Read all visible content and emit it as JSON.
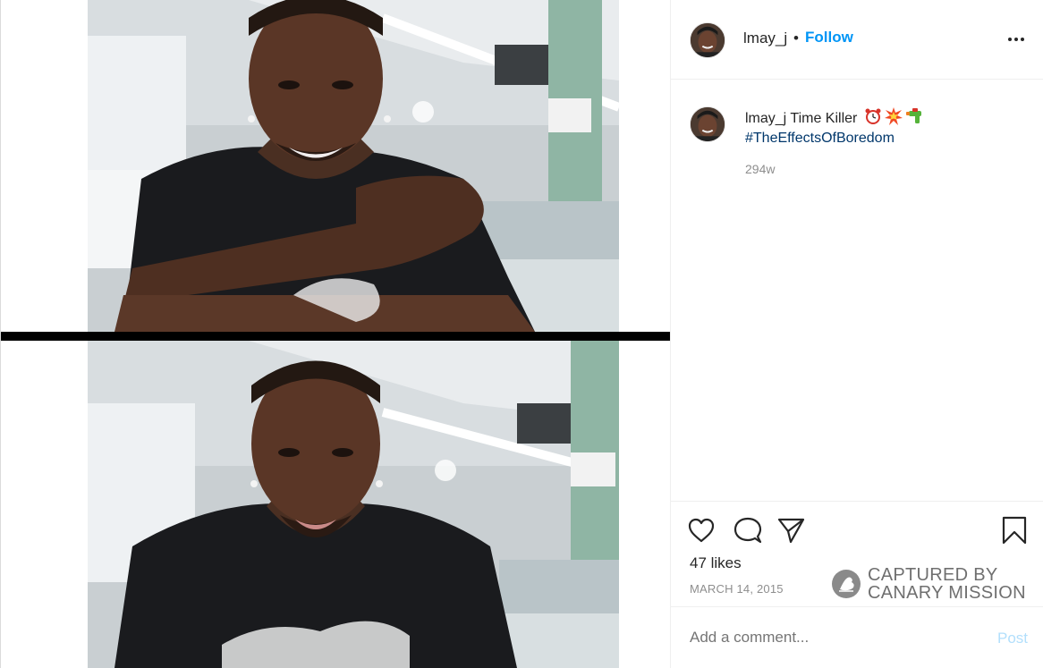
{
  "post": {
    "username": "lmay_j",
    "separator": "•",
    "follow_label": "Follow",
    "more_icon": "more-options-icon"
  },
  "caption": {
    "username": "lmay_j",
    "text": "Time Killer",
    "emojis": [
      "alarm-clock",
      "collision",
      "water-pistol"
    ],
    "hashtag": "#TheEffectsOfBoredom",
    "age": "294w"
  },
  "actions": {
    "icons": [
      "heart-icon",
      "comment-icon",
      "share-icon",
      "bookmark-icon"
    ],
    "likes": "47 likes",
    "date": "MARCH 14, 2015"
  },
  "watermark": {
    "line1": "CAPTURED BY",
    "line2": "CANARY MISSION"
  },
  "comment": {
    "placeholder": "Add a comment...",
    "post_label": "Post"
  },
  "colors": {
    "follow": "#0095f6",
    "hashtag": "#00376b",
    "post_disabled": "#b2dffc",
    "muted": "#8e8e8e"
  }
}
